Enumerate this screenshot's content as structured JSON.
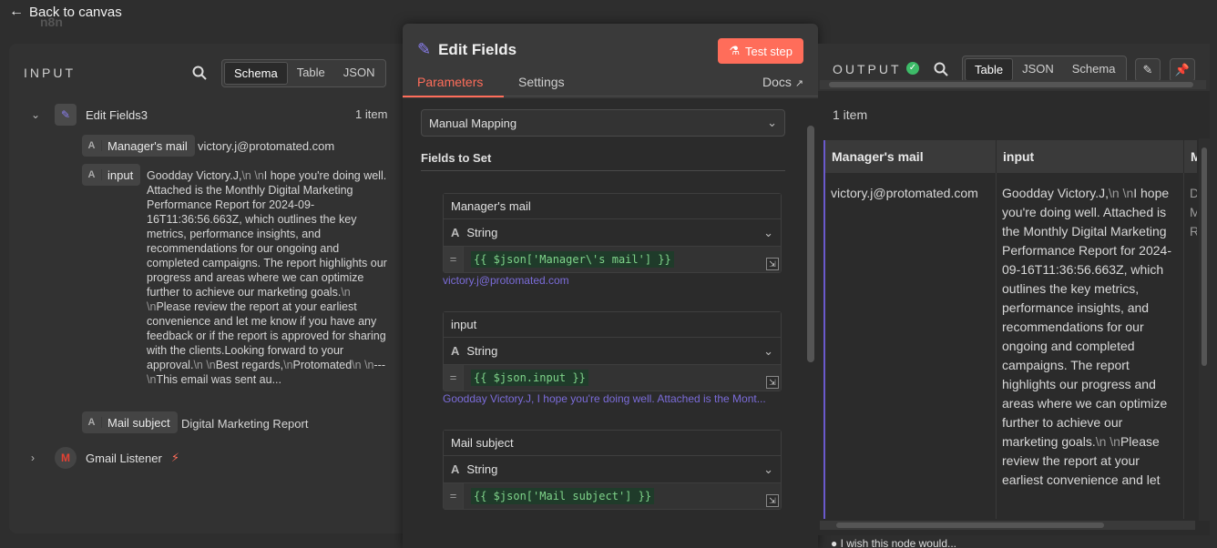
{
  "canvas": {
    "back_label": "Back to canvas",
    "logo_text": "n8n"
  },
  "input_panel": {
    "title": "INPUT",
    "view_tabs": [
      "Schema",
      "Table",
      "JSON"
    ],
    "active_tab": "Schema",
    "node": {
      "name": "Edit Fields3",
      "count": "1 item",
      "fields": [
        {
          "type": "A",
          "name": "Manager's mail",
          "value": "victory.j@protomated.com"
        },
        {
          "type": "A",
          "name": "input",
          "value_parts": [
            "Goodday Victory.J,",
            "\\n \\n",
            "I hope you're doing well. Attached is the Monthly Digital Marketing Performance Report for 2024-09-16T11:36:56.663Z, which outlines the key metrics, performance insights, and recommendations for our ongoing and completed campaigns. The report highlights our progress and areas where we can optimize further to achieve our marketing goals.",
            "\\n \\n",
            "Please review the report at your earliest convenience and let me know if you have any feedback or if the report is approved for sharing with the clients.Looking forward to your approval.",
            "\\n \\n",
            "Best regards,",
            "\\n",
            "Protomated",
            "\\n \\n",
            "---",
            "\\n",
            "This email was sent au..."
          ]
        },
        {
          "type": "A",
          "name": "Mail subject",
          "value": "Digital Marketing Report"
        }
      ]
    },
    "other_node": {
      "name": "Gmail Listener"
    }
  },
  "modal": {
    "title": "Edit Fields",
    "test_button": "Test step",
    "tabs": [
      "Parameters",
      "Settings"
    ],
    "docs_label": "Docs",
    "mode_select": "Manual Mapping",
    "section_label": "Fields to Set",
    "fields": [
      {
        "name": "Manager's mail",
        "type": "String",
        "expression": "{{ $json['Manager\\'s mail'] }}",
        "result": "victory.j@protomated.com"
      },
      {
        "name": "input",
        "type": "String",
        "expression": "{{ $json.input }}",
        "result": "Goodday Victory.J, I hope you're doing well. Attached is the Mont..."
      },
      {
        "name": "Mail subject",
        "type": "String",
        "expression": "{{ $json['Mail subject'] }}",
        "result": ""
      }
    ]
  },
  "output_panel": {
    "title": "OUTPUT",
    "view_tabs": [
      "Table",
      "JSON",
      "Schema"
    ],
    "active_tab": "Table",
    "count": "1 item",
    "columns": [
      "Manager's mail",
      "input",
      "M"
    ],
    "row": {
      "managers_mail": "victory.j@protomated.com",
      "input_parts": [
        "Goodday Victory.J,",
        "\\n \\n",
        "I hope you're doing well. Attached is the Monthly Digital Marketing Performance Report for 2024-09-16T11:36:56.663Z, which outlines the key metrics, performance insights, and recommendations for our ongoing and completed campaigns. The report highlights our progress and areas where we can optimize further to achieve our marketing goals.",
        "\\n \\n",
        "Please review the report at your earliest convenience and let"
      ],
      "third_col": "D\nM\nR"
    },
    "bottom_hint": "I wish this node would..."
  },
  "colors": {
    "accent": "#ff6d5a",
    "success": "#3dbb68",
    "expression_result": "#7b6cd9"
  }
}
